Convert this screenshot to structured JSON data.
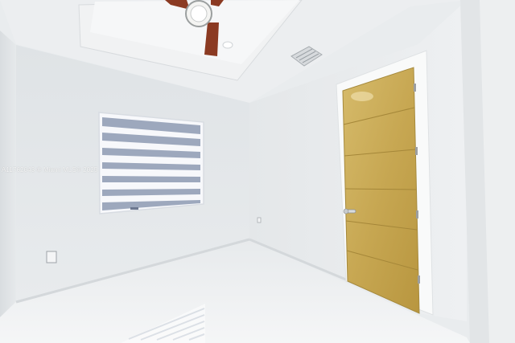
{
  "photo": {
    "watermark_text": "A11762043 © Miami MLS® 2025",
    "colors": {
      "wall_light": "#eceff1",
      "wall_shadow": "#d7dbde",
      "floor": "#f2f4f5",
      "door_wood": "#c9a955",
      "door_frame": "#ffffff",
      "fan_blade": "#8b3a22",
      "blind_stripe": "#7f8ea8"
    }
  }
}
